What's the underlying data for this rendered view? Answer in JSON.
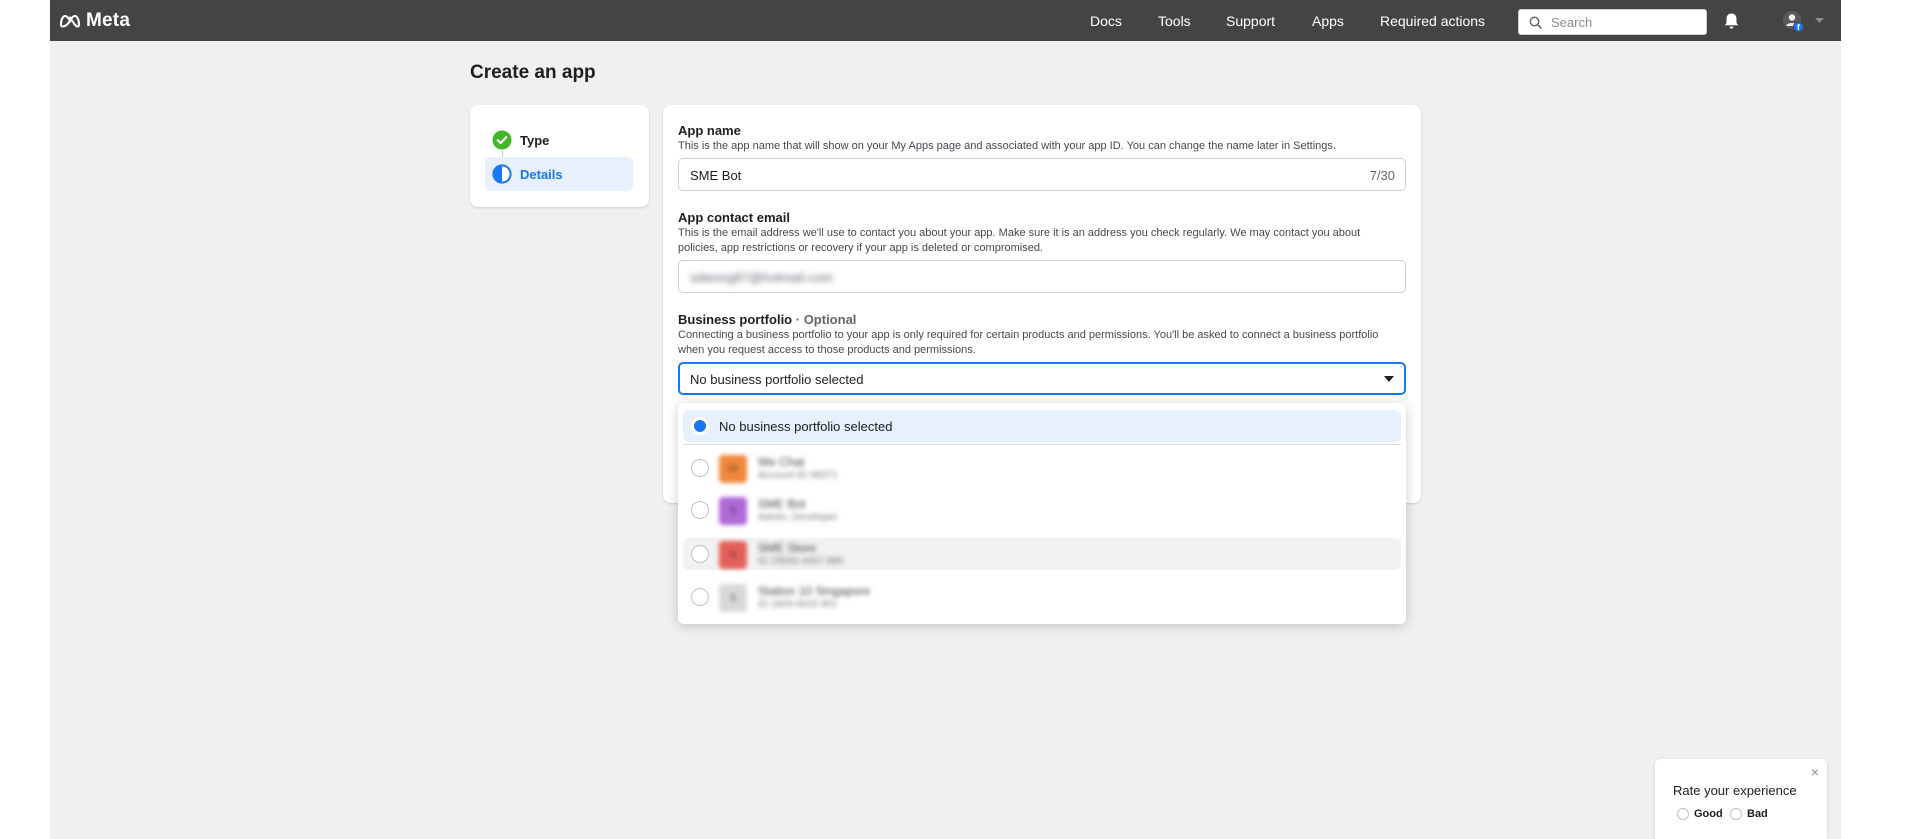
{
  "nav": {
    "logo": "Meta",
    "links": [
      "Docs",
      "Tools",
      "Support",
      "Apps",
      "Required actions"
    ],
    "search_placeholder": "Search"
  },
  "page": {
    "title": "Create an app"
  },
  "steps": [
    {
      "label": "Type",
      "state": "complete"
    },
    {
      "label": "Details",
      "state": "current"
    }
  ],
  "form": {
    "app_name": {
      "label": "App name",
      "help": "This is the app name that will show on your My Apps page and associated with your app ID. You can change the name later in Settings.",
      "value": "SME Bot",
      "counter": "7/30"
    },
    "contact_email": {
      "label": "App contact email",
      "help": "This is the email address we'll use to contact you about your app. Make sure it is an address you check regularly. We may contact you about policies, app restrictions or recovery if your app is deleted or compromised.",
      "value": "sdwong87@hotmail.com"
    },
    "business_portfolio": {
      "label": "Business portfolio",
      "optional": "· Optional",
      "help": "Connecting a business portfolio to your app is only required for certain products and permissions. You'll be asked to connect a business portfolio when you request access to those products and permissions.",
      "selected": "No business portfolio selected"
    }
  },
  "dropdown": {
    "selected_option": "No business portfolio selected",
    "options": [
      {
        "initial": "W",
        "color": "#f0883e",
        "name": "We Chat",
        "sub": "Account ID 48371",
        "hovered": false
      },
      {
        "initial": "S",
        "color": "#b06ad8",
        "name": "SME Bot",
        "sub": "Admin, Developer",
        "hovered": false
      },
      {
        "initial": "S",
        "color": "#e4605a",
        "name": "SME Store",
        "sub": "ID 29583 4467 880",
        "hovered": true
      },
      {
        "initial": "S",
        "color": "#d8d9db",
        "name": "Station 10 Singapore",
        "sub": "ID 1829 6620 901",
        "hovered": false
      }
    ]
  },
  "feedback": {
    "title": "Rate your experience",
    "good": "Good",
    "bad": "Bad",
    "close": "×"
  },
  "colors": {
    "accent": "#1877f2",
    "success": "#42b72a",
    "topbar": "#444444"
  }
}
